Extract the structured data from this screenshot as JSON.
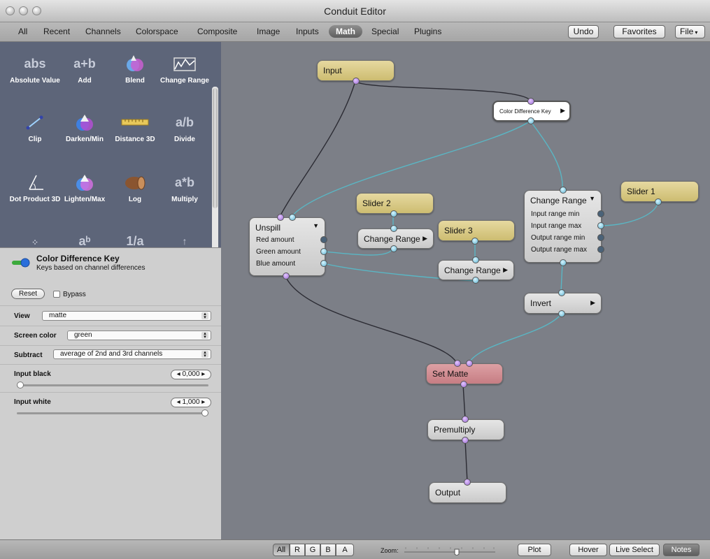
{
  "window": {
    "title": "Conduit Editor"
  },
  "tabs": [
    "All",
    "Recent",
    "Channels",
    "Colorspace",
    "Composite",
    "Image",
    "Inputs",
    "Math",
    "Special",
    "Plugins"
  ],
  "toolbar": {
    "undo": "Undo",
    "favorites": "Favorites",
    "file": "File"
  },
  "palette": [
    {
      "icon": "abs",
      "label": "Absolute Value"
    },
    {
      "icon": "a+b",
      "label": "Add"
    },
    {
      "icon": "blend-icon",
      "label": "Blend"
    },
    {
      "icon": "change-range-icon",
      "label": "Change Range"
    },
    {
      "icon": "clip-icon",
      "label": "Clip"
    },
    {
      "icon": "darken-icon",
      "label": "Darken/Min"
    },
    {
      "icon": "ruler-icon",
      "label": "Distance 3D"
    },
    {
      "icon": "a/b",
      "label": "Divide"
    },
    {
      "icon": "angle-icon",
      "label": "Dot Product 3D"
    },
    {
      "icon": "lighten-icon",
      "label": "Lighten/Max"
    },
    {
      "icon": "log-icon",
      "label": "Log"
    },
    {
      "icon": "a*b",
      "label": "Multiply"
    },
    {
      "icon": "sparkle-icon",
      "label": ""
    },
    {
      "icon": "aᵇ",
      "label": ""
    },
    {
      "icon": "1/a",
      "label": ""
    },
    {
      "icon": "curve-icon",
      "label": ""
    }
  ],
  "inspector": {
    "node_title": "Color Difference Key",
    "node_desc": "Keys based on channel differences",
    "reset": "Reset",
    "bypass": "Bypass",
    "view_label": "View",
    "view_value": "matte",
    "screen_label": "Screen color",
    "screen_value": "green",
    "subtract_label": "Subtract",
    "subtract_value": "average of 2nd and 3rd channels",
    "black_label": "Input black",
    "black_value": "0,000",
    "black_level": 0.0,
    "white_label": "Input white",
    "white_value": "1,000",
    "white_level": 1.0
  },
  "nodes": {
    "input": "Input",
    "cdk": "Color Difference Key",
    "slider1": "Slider 1",
    "slider2": "Slider 2",
    "slider3": "Slider 3",
    "cr_main": "Change Range",
    "cr_main_rows": [
      "Input range min",
      "Input range max",
      "Output range min",
      "Output range max"
    ],
    "cr_a": "Change Range",
    "cr_b": "Change Range",
    "unspill": "Unspill",
    "unspill_rows": [
      "Red amount",
      "Green amount",
      "Blue amount"
    ],
    "invert": "Invert",
    "setmatte": "Set Matte",
    "premult": "Premultiply",
    "output": "Output"
  },
  "bottom": {
    "channels": [
      "All",
      "R",
      "G",
      "B",
      "A"
    ],
    "zoom": "Zoom:",
    "plot": "Plot",
    "hover": "Hover",
    "live": "Live Select",
    "notes": "Notes"
  }
}
